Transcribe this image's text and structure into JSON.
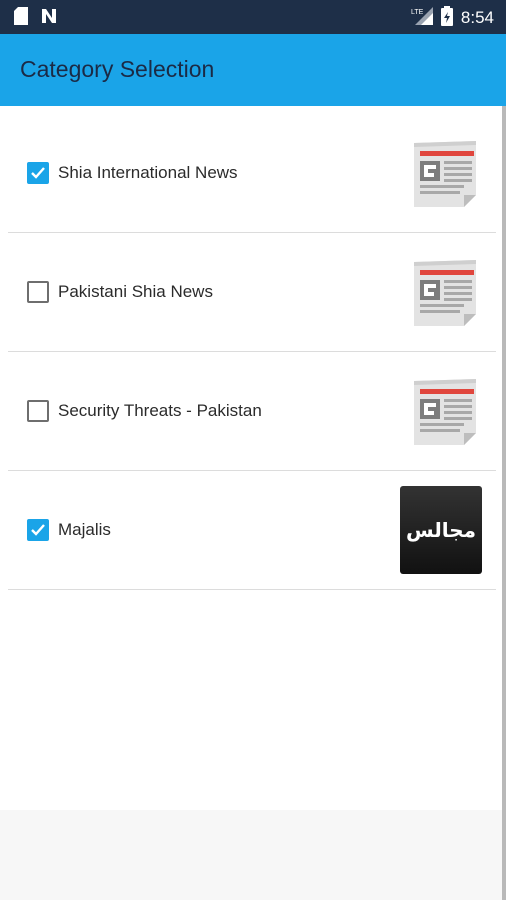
{
  "status_bar": {
    "left_icons": [
      "sd-card-icon",
      "n-notification-icon"
    ],
    "right_icons": [
      "lte-signal-icon",
      "battery-icon"
    ],
    "time": "8:54"
  },
  "app_bar": {
    "title": "Category Selection",
    "color": "#1aa4e8"
  },
  "categories": [
    {
      "label": "Shia International News",
      "checked": true,
      "icon": "newspaper-icon"
    },
    {
      "label": "Pakistani Shia News",
      "checked": false,
      "icon": "newspaper-icon"
    },
    {
      "label": "Security Threats - Pakistan",
      "checked": false,
      "icon": "newspaper-icon"
    },
    {
      "label": "Majalis",
      "checked": true,
      "icon": "majalis-thumbnail",
      "thumb_text": "مجالس"
    }
  ]
}
